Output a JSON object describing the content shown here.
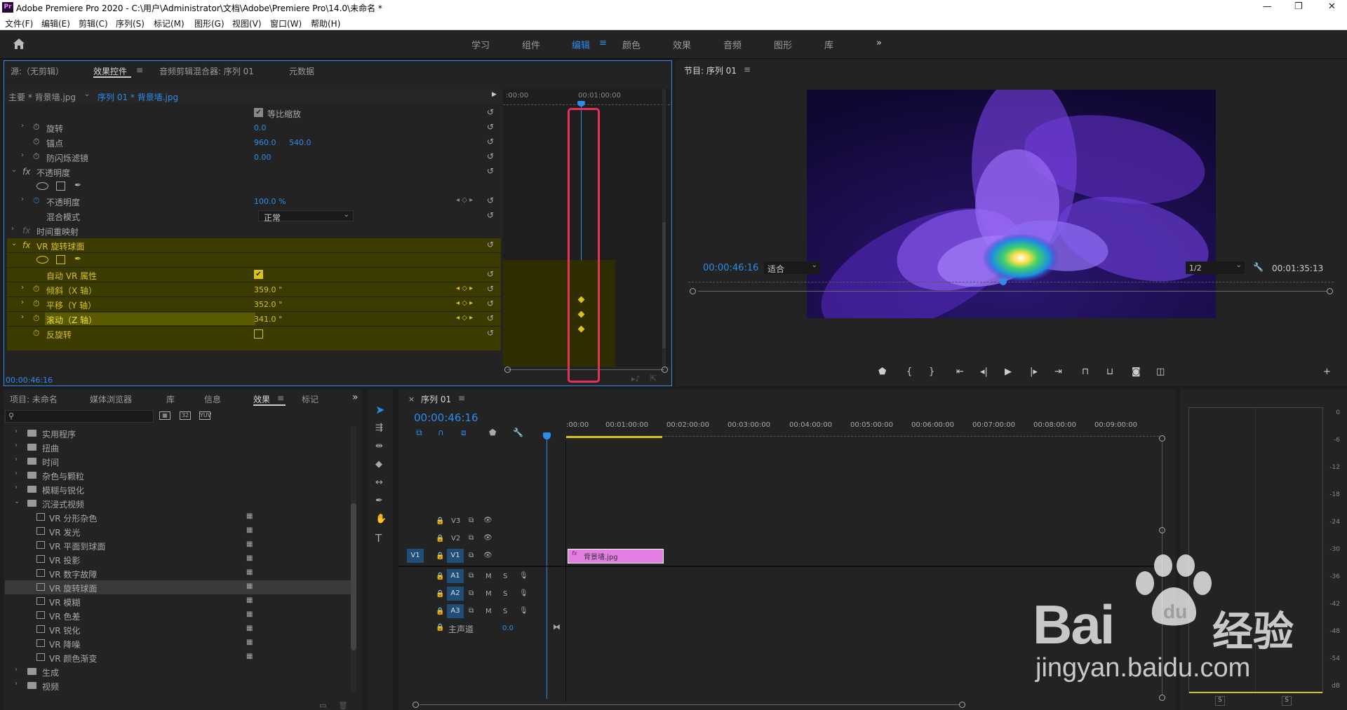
{
  "titlebar": {
    "title": "Adobe Premiere Pro 2020 - C:\\用户\\Administrator\\文档\\Adobe\\Premiere Pro\\14.0\\未命名 *",
    "minimize": "—",
    "restore": "❐",
    "close": "✕"
  },
  "menu": [
    "文件(F)",
    "编辑(E)",
    "剪辑(C)",
    "序列(S)",
    "标记(M)",
    "图形(G)",
    "视图(V)",
    "窗口(W)",
    "帮助(H)"
  ],
  "workspaces": [
    "学习",
    "组件",
    "编辑",
    "颜色",
    "效果",
    "音频",
    "图形",
    "库"
  ],
  "workspace_more": "»",
  "source_tabs": {
    "source": "源:（无剪辑）",
    "effect_controls": "效果控件",
    "audio_mixer": "音频剪辑混合器: 序列 01",
    "metadata": "元数据"
  },
  "ec": {
    "master": "主要 * 背景墙.jpg",
    "clip": "序列 01 * 背景墙.jpg",
    "ruler_start": ":00:00",
    "ruler_mid": "00:01:00:00",
    "uniform_scale": "等比缩放",
    "rotation": "旋转",
    "rotation_val": "0.0",
    "anchor": "锚点",
    "anchor_x": "960.0",
    "anchor_y": "540.0",
    "flicker": "防闪烁滤镜",
    "flicker_val": "0.00",
    "opacity_fx": "不透明度",
    "opacity": "不透明度",
    "opacity_val": "100.0 %",
    "blend": "混合模式",
    "blend_val": "正常",
    "time_remap": "时间重映射",
    "vr_fx": "VR 旋转球面",
    "auto_vr": "自动 VR 属性",
    "tilt": "倾斜（X 轴）",
    "tilt_val": "359.0 °",
    "pan": "平移（Y 轴）",
    "pan_val": "352.0 °",
    "roll": "滚动（Z 轴）",
    "roll_val": "341.0 °",
    "reverse": "反旋转",
    "timecode": "00:00:46:16"
  },
  "program": {
    "title": "节目: 序列 01",
    "timecode": "00:00:46:16",
    "fit": "适合",
    "res": "1/2",
    "duration": "00:01:35:13"
  },
  "project": {
    "tabs": [
      "项目: 未命名",
      "媒体浏览器",
      "库",
      "信息",
      "效果",
      "标记"
    ],
    "folders_top": [
      "实用程序",
      "扭曲",
      "时间",
      "杂色与颗粒",
      "模糊与锐化",
      "沉浸式视频"
    ],
    "vr_effects": [
      "VR 分形杂色",
      "VR 发光",
      "VR 平面到球面",
      "VR 投影",
      "VR 数字故障",
      "VR 旋转球面",
      "VR 模糊",
      "VR 色差",
      "VR 锐化",
      "VR 降噪",
      "VR 颜色渐变"
    ],
    "folders_bottom": [
      "生成",
      "视频"
    ]
  },
  "timeline": {
    "title": "序列 01",
    "timecode": "00:00:46:16",
    "ruler": [
      ":00:00",
      "00:01:00:00",
      "00:02:00:00",
      "00:03:00:00",
      "00:04:00:00",
      "00:05:00:00",
      "00:06:00:00",
      "00:07:00:00",
      "00:08:00:00",
      "00:09:00:00"
    ],
    "video_tracks": [
      "V3",
      "V2",
      "V1"
    ],
    "source_v": "V1",
    "audio_tracks": [
      "A1",
      "A2",
      "A3"
    ],
    "master": "主声道",
    "master_val": "0.0",
    "clip": "背景墙.jpg",
    "m": "M",
    "s": "S"
  },
  "meter": {
    "labels": [
      "0",
      "-6",
      "-12",
      "-18",
      "-24",
      "-30",
      "-36",
      "-42",
      "-48",
      "-54",
      "dB"
    ],
    "solo": "S"
  },
  "watermark": {
    "text1": "Bai",
    "text2": "经验",
    "url": "jingyan.baidu.com"
  },
  "colors": {
    "accent": "#2d8ceb",
    "highlight_box": "#e8315a",
    "keyframe": "#d8c21c",
    "clip": "#e37fe3"
  }
}
